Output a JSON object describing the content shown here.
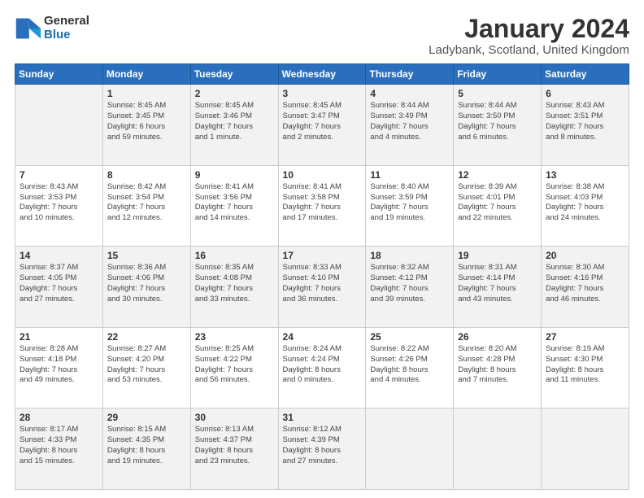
{
  "logo": {
    "general": "General",
    "blue": "Blue"
  },
  "title": {
    "month_year": "January 2024",
    "location": "Ladybank, Scotland, United Kingdom"
  },
  "headers": [
    "Sunday",
    "Monday",
    "Tuesday",
    "Wednesday",
    "Thursday",
    "Friday",
    "Saturday"
  ],
  "weeks": [
    [
      {
        "day": "",
        "info": ""
      },
      {
        "day": "1",
        "info": "Sunrise: 8:45 AM\nSunset: 3:45 PM\nDaylight: 6 hours\nand 59 minutes."
      },
      {
        "day": "2",
        "info": "Sunrise: 8:45 AM\nSunset: 3:46 PM\nDaylight: 7 hours\nand 1 minute."
      },
      {
        "day": "3",
        "info": "Sunrise: 8:45 AM\nSunset: 3:47 PM\nDaylight: 7 hours\nand 2 minutes."
      },
      {
        "day": "4",
        "info": "Sunrise: 8:44 AM\nSunset: 3:49 PM\nDaylight: 7 hours\nand 4 minutes."
      },
      {
        "day": "5",
        "info": "Sunrise: 8:44 AM\nSunset: 3:50 PM\nDaylight: 7 hours\nand 6 minutes."
      },
      {
        "day": "6",
        "info": "Sunrise: 8:43 AM\nSunset: 3:51 PM\nDaylight: 7 hours\nand 8 minutes."
      }
    ],
    [
      {
        "day": "7",
        "info": "Sunrise: 8:43 AM\nSunset: 3:53 PM\nDaylight: 7 hours\nand 10 minutes."
      },
      {
        "day": "8",
        "info": "Sunrise: 8:42 AM\nSunset: 3:54 PM\nDaylight: 7 hours\nand 12 minutes."
      },
      {
        "day": "9",
        "info": "Sunrise: 8:41 AM\nSunset: 3:56 PM\nDaylight: 7 hours\nand 14 minutes."
      },
      {
        "day": "10",
        "info": "Sunrise: 8:41 AM\nSunset: 3:58 PM\nDaylight: 7 hours\nand 17 minutes."
      },
      {
        "day": "11",
        "info": "Sunrise: 8:40 AM\nSunset: 3:59 PM\nDaylight: 7 hours\nand 19 minutes."
      },
      {
        "day": "12",
        "info": "Sunrise: 8:39 AM\nSunset: 4:01 PM\nDaylight: 7 hours\nand 22 minutes."
      },
      {
        "day": "13",
        "info": "Sunrise: 8:38 AM\nSunset: 4:03 PM\nDaylight: 7 hours\nand 24 minutes."
      }
    ],
    [
      {
        "day": "14",
        "info": "Sunrise: 8:37 AM\nSunset: 4:05 PM\nDaylight: 7 hours\nand 27 minutes."
      },
      {
        "day": "15",
        "info": "Sunrise: 8:36 AM\nSunset: 4:06 PM\nDaylight: 7 hours\nand 30 minutes."
      },
      {
        "day": "16",
        "info": "Sunrise: 8:35 AM\nSunset: 4:08 PM\nDaylight: 7 hours\nand 33 minutes."
      },
      {
        "day": "17",
        "info": "Sunrise: 8:33 AM\nSunset: 4:10 PM\nDaylight: 7 hours\nand 36 minutes."
      },
      {
        "day": "18",
        "info": "Sunrise: 8:32 AM\nSunset: 4:12 PM\nDaylight: 7 hours\nand 39 minutes."
      },
      {
        "day": "19",
        "info": "Sunrise: 8:31 AM\nSunset: 4:14 PM\nDaylight: 7 hours\nand 43 minutes."
      },
      {
        "day": "20",
        "info": "Sunrise: 8:30 AM\nSunset: 4:16 PM\nDaylight: 7 hours\nand 46 minutes."
      }
    ],
    [
      {
        "day": "21",
        "info": "Sunrise: 8:28 AM\nSunset: 4:18 PM\nDaylight: 7 hours\nand 49 minutes."
      },
      {
        "day": "22",
        "info": "Sunrise: 8:27 AM\nSunset: 4:20 PM\nDaylight: 7 hours\nand 53 minutes."
      },
      {
        "day": "23",
        "info": "Sunrise: 8:25 AM\nSunset: 4:22 PM\nDaylight: 7 hours\nand 56 minutes."
      },
      {
        "day": "24",
        "info": "Sunrise: 8:24 AM\nSunset: 4:24 PM\nDaylight: 8 hours\nand 0 minutes."
      },
      {
        "day": "25",
        "info": "Sunrise: 8:22 AM\nSunset: 4:26 PM\nDaylight: 8 hours\nand 4 minutes."
      },
      {
        "day": "26",
        "info": "Sunrise: 8:20 AM\nSunset: 4:28 PM\nDaylight: 8 hours\nand 7 minutes."
      },
      {
        "day": "27",
        "info": "Sunrise: 8:19 AM\nSunset: 4:30 PM\nDaylight: 8 hours\nand 11 minutes."
      }
    ],
    [
      {
        "day": "28",
        "info": "Sunrise: 8:17 AM\nSunset: 4:33 PM\nDaylight: 8 hours\nand 15 minutes."
      },
      {
        "day": "29",
        "info": "Sunrise: 8:15 AM\nSunset: 4:35 PM\nDaylight: 8 hours\nand 19 minutes."
      },
      {
        "day": "30",
        "info": "Sunrise: 8:13 AM\nSunset: 4:37 PM\nDaylight: 8 hours\nand 23 minutes."
      },
      {
        "day": "31",
        "info": "Sunrise: 8:12 AM\nSunset: 4:39 PM\nDaylight: 8 hours\nand 27 minutes."
      },
      {
        "day": "",
        "info": ""
      },
      {
        "day": "",
        "info": ""
      },
      {
        "day": "",
        "info": ""
      }
    ]
  ]
}
